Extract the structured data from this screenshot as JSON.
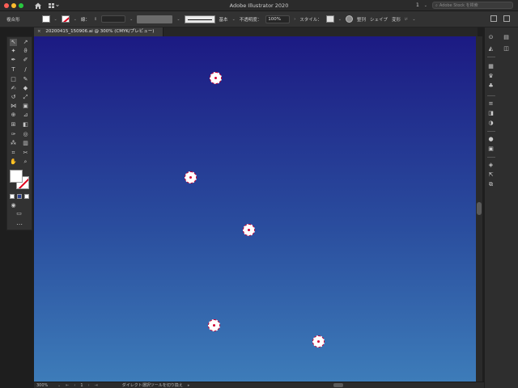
{
  "window": {
    "title": "Adobe Illustrator 2020",
    "search_placeholder": "Adobe Stock を検索",
    "page_indicator": "1"
  },
  "control_bar": {
    "selection_label": "複合形",
    "stroke_label": "線：",
    "stroke_profile": "基本",
    "opacity_label": "不透明度：",
    "opacity_value": "100%",
    "style_label": "スタイル：",
    "align_label": "整列",
    "shape_label": "シェイプ",
    "transform_label": "変形"
  },
  "document_tab": {
    "close_glyph": "×",
    "label": "20200415_150906.ai @ 300% (CMYK/プレビュー)"
  },
  "canvas": {
    "gradient_top": "#1c1a83",
    "gradient_bottom": "#3d7cb9",
    "anchor_stroke_color": "#d10033"
  },
  "status_bar": {
    "zoom": "300%",
    "artboard": "1",
    "tool_status": "ダイレクト選択ツールを切り換え"
  },
  "icons": {
    "home": "home-icon",
    "workspace": "workspace-icon",
    "search": "search-icon",
    "arrange": "arrange-documents-icon",
    "panel_toggle": "panel-toggle-icon"
  }
}
